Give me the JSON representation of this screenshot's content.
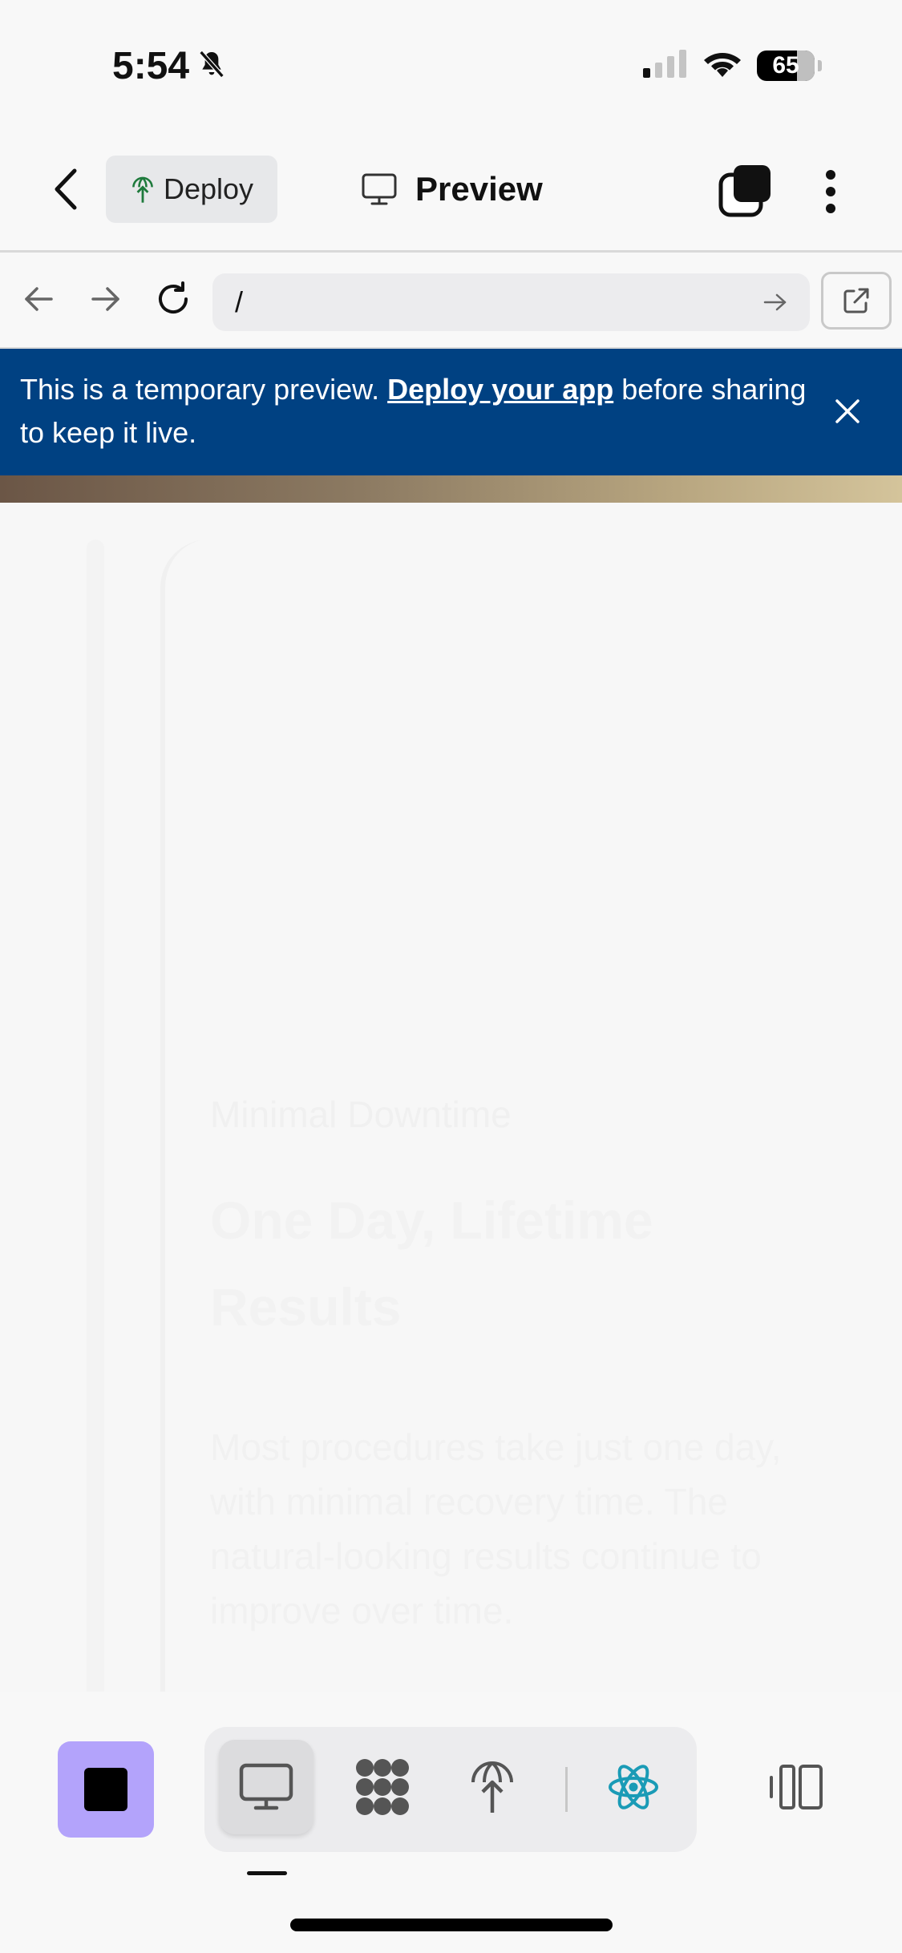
{
  "status_bar": {
    "time": "5:54",
    "battery": "65"
  },
  "topbar": {
    "deploy_label": "Deploy",
    "preview_label": "Preview"
  },
  "url_bar": {
    "url": "/"
  },
  "banner": {
    "text_before": "This is a temporary preview. ",
    "link_text": "Deploy your app",
    "text_after": " before sharing to keep it live."
  },
  "hero": {
    "eyebrow": "Minimal Downtime",
    "title": "One Day, Lifetime Results",
    "body": "Most procedures take just one day, with minimal recovery time. The natural-looking results continue to improve over time."
  },
  "colors": {
    "banner_bg": "#004182",
    "stop_button": "#b3a3fb",
    "react_icon": "#1a9bb6",
    "deploy_icon": "#1e7a3c"
  }
}
